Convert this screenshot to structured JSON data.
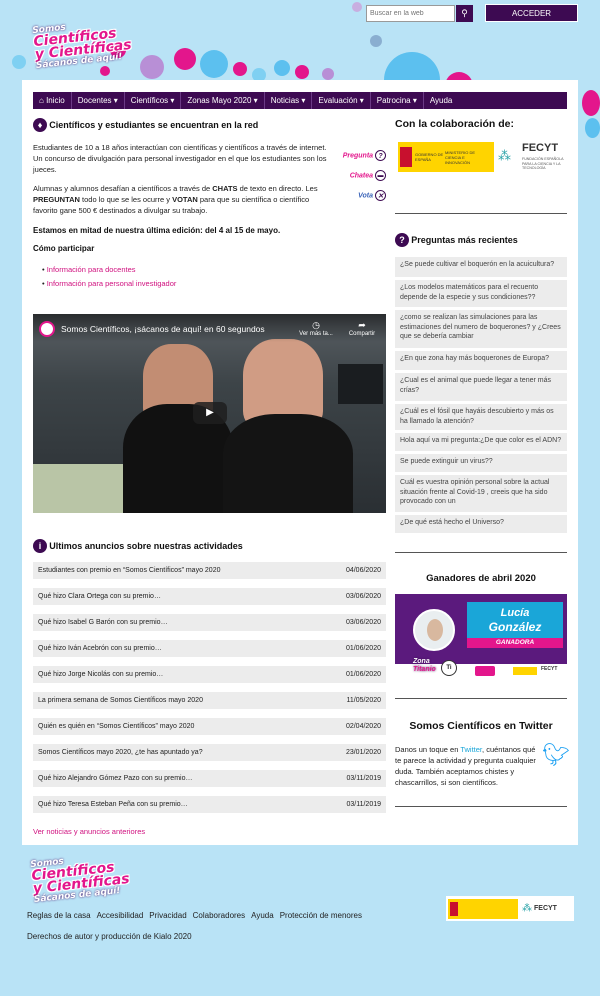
{
  "search": {
    "placeholder": "Buscar en la web"
  },
  "header": {
    "acceder": "ACCEDER"
  },
  "logo": {
    "l1": "Somos",
    "l2a": "Científicos",
    "l2b": "y Científicas",
    "l3": "Sácanos de aquí!"
  },
  "nav": [
    "Inicio",
    "Docentes",
    "Científicos",
    "Zonas Mayo 2020",
    "Noticias",
    "Evaluación",
    "Patrocina",
    "Ayuda"
  ],
  "intro": {
    "title": "Científicos y estudiantes se encuentran en la red",
    "p1": "Estudiantes de 10 a 18 años interactúan con científicas y científicos a través de internet. Un concurso de divulgación para personal investigador en el que los estudiantes son los jueces.",
    "p2a": "Alumnas y alumnos desafían a científicos a través de ",
    "p2b": "CHATS",
    "p2c": " de texto en directo. Les ",
    "p2d": "PREGUNTAN",
    "p2e": " todo lo que se les ocurre y ",
    "p2f": "VOTAN",
    "p2g": " para que su científica o científico favorito gane 500 € destinados a divulgar su trabajo.",
    "edition": "Estamos en mitad de nuestra última edición: del 4 al 15 de mayo.",
    "how": "Cómo participar",
    "link1": "Información para docentes",
    "link2": "Información para personal investigador",
    "badges": [
      "Pregunta",
      "Chatea",
      "Vota"
    ]
  },
  "video": {
    "title": "Somos Científicos, ¡sácanos de aquí! en 60 segundos",
    "later": "Ver más ta...",
    "share": "Compartir"
  },
  "news": {
    "title": "Ultimos anuncios sobre nuestras actividades",
    "rows": [
      {
        "t": "Estudiantes con premio en “Somos Científicos” mayo 2020",
        "d": "04/06/2020"
      },
      {
        "t": "Qué hizo Clara Ortega con su premio…",
        "d": "03/06/2020"
      },
      {
        "t": "Qué hizo Isabel G Barón con su premio…",
        "d": "03/06/2020"
      },
      {
        "t": "Qué hizo Iván Acebrón con su premio…",
        "d": "01/06/2020"
      },
      {
        "t": "Qué hizo Jorge Nicolás con su premio…",
        "d": "01/06/2020"
      },
      {
        "t": "La primera semana de Somos Científicos mayo 2020",
        "d": "11/05/2020"
      },
      {
        "t": "Quién es quién en “Somos Científicos” mayo 2020",
        "d": "02/04/2020"
      },
      {
        "t": "Somos Científicos mayo 2020, ¿te has apuntado ya?",
        "d": "23/01/2020"
      },
      {
        "t": "Qué hizo Alejandro Gómez Pazo con su premio…",
        "d": "03/11/2019"
      },
      {
        "t": "Qué hizo Teresa Esteban Peña con su premio…",
        "d": "03/11/2019"
      }
    ],
    "more": "Ver noticias y anuncios anteriores"
  },
  "side": {
    "collab": "Con la colaboración de:",
    "fecyt": "FECYT",
    "fecyt_sub": "FUNDACIÓN ESPAÑOLA PARA LA CIENCIA Y LA TECNOLOGÍA",
    "gob": "GOBIERNO DE ESPAÑA",
    "min": "MINISTERIO DE CIENCIA E INNOVACIÓN",
    "questions_title": "Preguntas más recientes",
    "questions": [
      "¿Se puede cultivar el boquerón en la acuicultura?",
      "¿Los modelos matemáticos para el recuento depende de la especie y sus condiciones??",
      "¿como se realizan las simulaciones para las estimaciones del numero de boquerones? y ¿Crees que se debería cambiar",
      "¿En que zona hay más boquerones de Europa?",
      "¿Cual es el animal que puede llegar a tener más crías?",
      "¿Cuál es el fósil que hayáis descubierto y más os ha llamado la atención?",
      "Hola aquí va mi pregunta:¿De que color es el ADN?",
      "Se puede extinguir un virus??",
      "Cuál es vuestra opinión personal sobre la actual situación frente al Covid-19 , creeis que ha sido provocado con un",
      "¿De qué está hecho el Universo?"
    ],
    "winners_title": "Ganadores de abril 2020",
    "winner_first": "Lucía",
    "winner_last": "González",
    "winner_badge": "GANADORA",
    "zona": "Zona",
    "zona2": "Titanio",
    "twitter_title": "Somos Científicos en Twitter",
    "tw_a": "Danos un toque en ",
    "tw_link": "Twitter",
    "tw_b": ", cuéntanos qué te parece la actividad y pregunta cualquier duda. También aceptamos chistes y chascarrillos, si son científicos."
  },
  "footer": {
    "links": [
      "Reglas de la casa",
      "Accesibilidad",
      "Privacidad",
      "Colaboradores",
      "Ayuda",
      "Protección de menores"
    ],
    "copyright": "Derechos de autor y producción de Kialo 2020"
  },
  "colors": {
    "purple": "#3d0a52",
    "pink": "#e3168c",
    "bg": "#b9e3f6"
  }
}
